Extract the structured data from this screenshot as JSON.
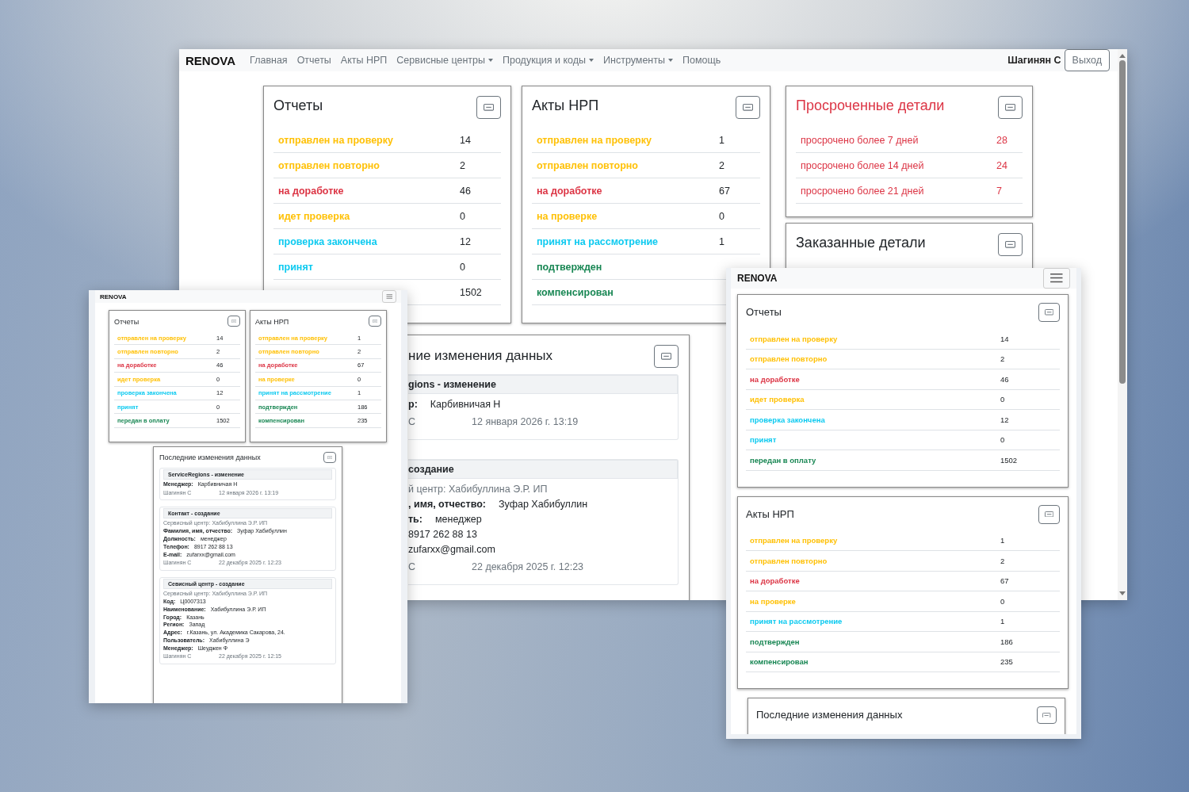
{
  "main_window": {
    "navbar": {
      "brand": "RENOVA",
      "links": [
        {
          "label": "Главная",
          "dropdown": false
        },
        {
          "label": "Отчеты",
          "dropdown": false
        },
        {
          "label": "Акты НРП",
          "dropdown": false
        },
        {
          "label": "Сервисные центры",
          "dropdown": true
        },
        {
          "label": "Продукция и коды",
          "dropdown": true
        },
        {
          "label": "Инструменты",
          "dropdown": true
        },
        {
          "label": "Помощь",
          "dropdown": false
        }
      ],
      "user": "Шагинян С",
      "logout": "Выход"
    },
    "cards": [
      {
        "title": "Отчеты",
        "kind": "status",
        "rows": [
          {
            "label": "отправлен на проверку",
            "value": "14",
            "color": "#ffc107"
          },
          {
            "label": "отправлен повторно",
            "value": "2",
            "color": "#ffc107"
          },
          {
            "label": "на доработке",
            "value": "46",
            "color": "#dc3545"
          },
          {
            "label": "идет проверка",
            "value": "0",
            "color": "#ffc107"
          },
          {
            "label": "проверка закончена",
            "value": "12",
            "color": "#0dcaf0"
          },
          {
            "label": "принят",
            "value": "0",
            "color": "#0dcaf0"
          },
          {
            "value": "1502"
          }
        ]
      },
      {
        "title": "Акты НРП",
        "kind": "status",
        "rows": [
          {
            "label": "отправлен на проверку",
            "value": "1",
            "color": "#ffc107"
          },
          {
            "label": "отправлен повторно",
            "value": "2",
            "color": "#ffc107"
          },
          {
            "label": "на доработке",
            "value": "67",
            "color": "#dc3545"
          },
          {
            "label": "на проверке",
            "value": "0",
            "color": "#ffc107"
          },
          {
            "label": "принят на рассмотрение",
            "value": "1",
            "color": "#0dcaf0"
          },
          {
            "label": "подтвержден",
            "color": "#198754"
          },
          {
            "label": "компенсирован",
            "color": "#198754"
          }
        ]
      },
      {
        "title": "Просроченные детали",
        "kind": "alert",
        "rows": [
          {
            "label": "просрочено более 7 дней",
            "value": "28",
            "color": "#dc3545"
          },
          {
            "label": "просрочено более 14 дней",
            "value": "24",
            "color": "#dc3545"
          },
          {
            "label": "просрочено более 21 дней",
            "value": "7",
            "color": "#dc3545"
          }
        ]
      },
      {
        "title": "Заказанные детали",
        "kind": "status"
      }
    ],
    "recent_changes": {
      "title": "ние изменения данных",
      "entries": [
        {
          "heading": "gions - изменение",
          "fields": [
            {
              "label": "р:",
              "value": "Карбивничая Н"
            }
          ],
          "author": "С",
          "date": "12 января 2026 г. 13:19"
        },
        {
          "heading": "создание",
          "note": "й центр: Хабибуллина Э.Р. ИП",
          "fields": [
            {
              "label": ", имя, отчество:",
              "value": "Зуфар Хабибуллин"
            },
            {
              "label": "ть:",
              "value": "менеджер"
            },
            {
              "value": "8917 262 88 13"
            },
            {
              "value": "zufarxx@gmail.com"
            }
          ],
          "author": "С",
          "date": "22 декабря 2025 г. 12:23"
        }
      ]
    }
  },
  "left_window": {
    "brand": "RENOVA",
    "cards": [
      {
        "title": "Отчеты",
        "kind": "status",
        "rows": [
          {
            "label": "отправлен на проверку",
            "value": "14",
            "color": "#ffc107"
          },
          {
            "label": "отправлен повторно",
            "value": "2",
            "color": "#ffc107"
          },
          {
            "label": "на доработке",
            "value": "46",
            "color": "#dc3545"
          },
          {
            "label": "идет проверка",
            "value": "0",
            "color": "#ffc107"
          },
          {
            "label": "проверка закончена",
            "value": "12",
            "color": "#0dcaf0"
          },
          {
            "label": "принят",
            "value": "0",
            "color": "#0dcaf0"
          },
          {
            "label": "передан в оплату",
            "value": "1502",
            "color": "#198754"
          }
        ]
      },
      {
        "title": "Акты НРП",
        "kind": "status",
        "rows": [
          {
            "label": "отправлен на проверку",
            "value": "1",
            "color": "#ffc107"
          },
          {
            "label": "отправлен повторно",
            "value": "2",
            "color": "#ffc107"
          },
          {
            "label": "на доработке",
            "value": "67",
            "color": "#dc3545"
          },
          {
            "label": "на проверке",
            "value": "0",
            "color": "#ffc107"
          },
          {
            "label": "принят на рассмотрение",
            "value": "1",
            "color": "#0dcaf0"
          },
          {
            "label": "подтвержден",
            "value": "186",
            "color": "#198754"
          },
          {
            "label": "компенсирован",
            "value": "235",
            "color": "#198754"
          }
        ]
      }
    ],
    "recent_changes": {
      "title": "Последние изменения данных",
      "entries": [
        {
          "heading": "ServiceRegions - изменение",
          "fields": [
            {
              "label": "Менеджер:",
              "value": "Карбивничая Н"
            }
          ],
          "author": "Шагинян С",
          "date": "12 января 2026 г. 13:19"
        },
        {
          "heading": "Контакт - создание",
          "note": "Сервисный центр: Хабибуллина Э.Р. ИП",
          "fields": [
            {
              "label": "Фамилия, имя, отчество:",
              "value": "Зуфар Хабибуллин"
            },
            {
              "label": "Должность:",
              "value": "менеджер"
            },
            {
              "label": "Телефон:",
              "value": "8917 262 88 13"
            },
            {
              "label": "E-mail:",
              "value": "zufarxx@gmail.com"
            }
          ],
          "author": "Шагинян С",
          "date": "22 декабря 2025 г. 12:23"
        },
        {
          "heading": "Севисный центр - создание",
          "note": "Сервисный центр: Хабибуллина Э.Р. ИП",
          "fields": [
            {
              "label": "Код:",
              "value": "Ц0007313"
            },
            {
              "label": "Наименование:",
              "value": "Хабибуллина Э.Р. ИП"
            },
            {
              "label": "Город:",
              "value": "Казань"
            },
            {
              "label": "Регион:",
              "value": "Запад"
            },
            {
              "label": "Адрес:",
              "value": "г.Казань, ул. Академика Сакарова, 24."
            },
            {
              "label": "Пользователь:",
              "value": "Хабибуллина Э"
            },
            {
              "label": "Менеджер:",
              "value": "Шеуджен Ф"
            }
          ],
          "author": "Шагинян С",
          "date": "22 декабря 2025 г. 12:15"
        }
      ]
    }
  },
  "right_window": {
    "brand": "RENOVA",
    "cards": [
      {
        "title": "Отчеты",
        "kind": "status",
        "rows": [
          {
            "label": "отправлен на проверку",
            "value": "14",
            "color": "#ffc107"
          },
          {
            "label": "отправлен повторно",
            "value": "2",
            "color": "#ffc107"
          },
          {
            "label": "на доработке",
            "value": "46",
            "color": "#dc3545"
          },
          {
            "label": "идет проверка",
            "value": "0",
            "color": "#ffc107"
          },
          {
            "label": "проверка закончена",
            "value": "12",
            "color": "#0dcaf0"
          },
          {
            "label": "принят",
            "value": "0",
            "color": "#0dcaf0"
          },
          {
            "label": "передан в оплату",
            "value": "1502",
            "color": "#198754"
          }
        ]
      },
      {
        "title": "Акты НРП",
        "kind": "status",
        "rows": [
          {
            "label": "отправлен на проверку",
            "value": "1",
            "color": "#ffc107"
          },
          {
            "label": "отправлен повторно",
            "value": "2",
            "color": "#ffc107"
          },
          {
            "label": "на доработке",
            "value": "67",
            "color": "#dc3545"
          },
          {
            "label": "на проверке",
            "value": "0",
            "color": "#ffc107"
          },
          {
            "label": "принят на рассмотрение",
            "value": "1",
            "color": "#0dcaf0"
          },
          {
            "label": "подтвержден",
            "value": "186",
            "color": "#198754"
          },
          {
            "label": "компенсирован",
            "value": "235",
            "color": "#198754"
          }
        ]
      }
    ],
    "recent_changes": {
      "title": "Последние изменения данных"
    }
  }
}
